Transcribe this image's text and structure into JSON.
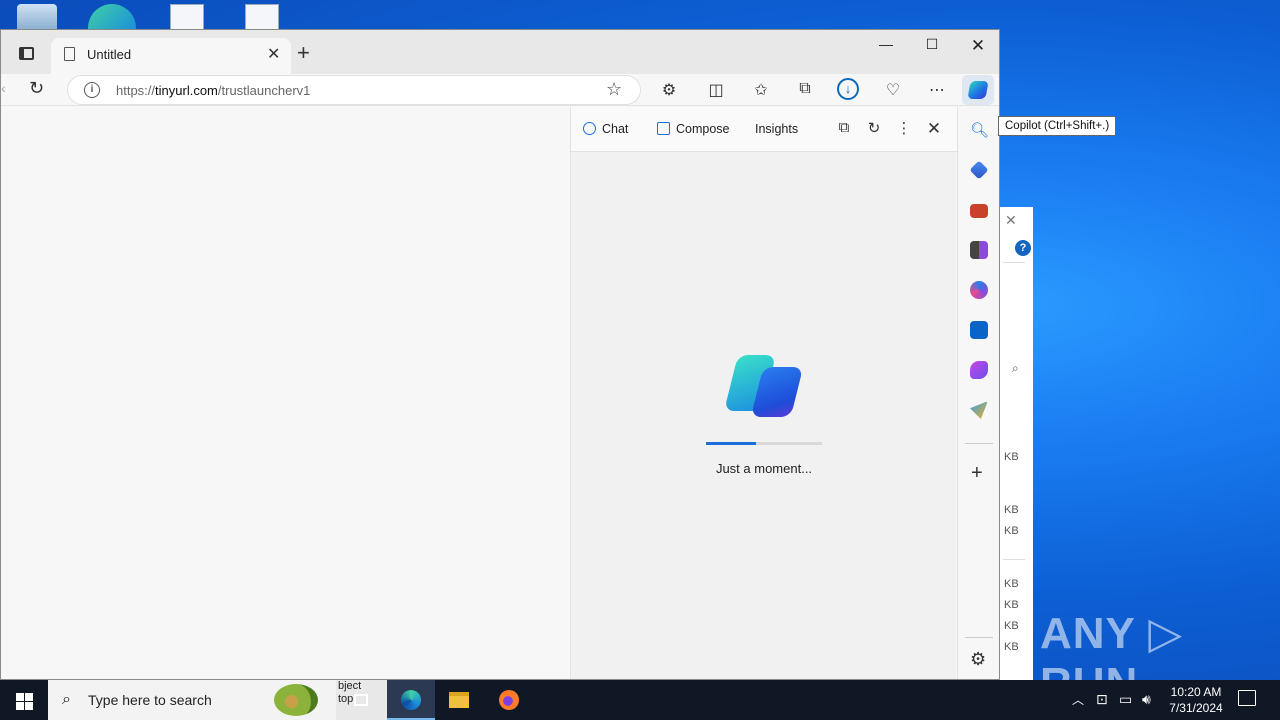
{
  "browser": {
    "tab_title": "Untitled",
    "url_domain": "tinyurl.com",
    "url_prefix": "https://",
    "url_path": "/trustlauncherv1"
  },
  "copilot_pane": {
    "tabs": [
      "Chat",
      "Compose",
      "Insights"
    ],
    "loading_text": "Just a moment...",
    "progress": 0.43
  },
  "tooltip": "Copilot (Ctrl+Shift+.)",
  "background_window": {
    "sizes": [
      "KB",
      "KB",
      "KB",
      "KB",
      "KB",
      "KB",
      "KB"
    ]
  },
  "taskbar": {
    "search_placeholder": "Type here to search",
    "clipped_text_line1": "bject",
    "clipped_text_line2": "top",
    "time": "10:20 AM",
    "date": "7/31/2024"
  },
  "watermark": "ANY ▷ RUN",
  "colors": {
    "accent": "#1a6fd9",
    "desktop": "#0d5fd4",
    "taskbar": "#101826"
  }
}
